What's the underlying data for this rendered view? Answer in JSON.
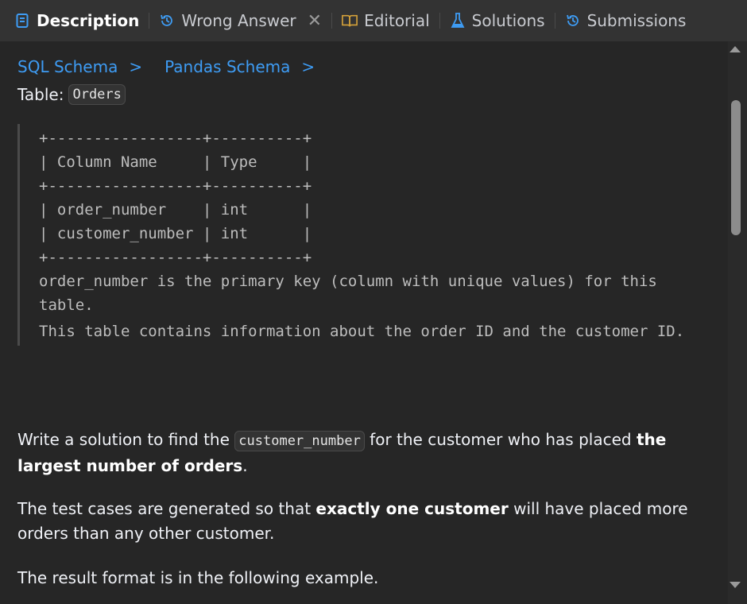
{
  "tabs": [
    {
      "label": "Description",
      "icon": "description-icon",
      "active": true
    },
    {
      "label": "Wrong Answer",
      "icon": "history-icon",
      "closable": true
    },
    {
      "label": "Editorial",
      "icon": "book-icon"
    },
    {
      "label": "Solutions",
      "icon": "flask-icon"
    },
    {
      "label": "Submissions",
      "icon": "history-icon"
    }
  ],
  "breadcrumb": [
    "SQL Schema",
    "Pandas Schema"
  ],
  "table_label": "Table:",
  "table_name": "Orders",
  "schema_ascii": "+-----------------+----------+\n| Column Name     | Type     |\n+-----------------+----------+\n| order_number    | int      |\n| customer_number | int      |\n+-----------------+----------+",
  "schema_notes": [
    "order_number is the primary key (column with unique values) for this table.",
    "This table contains information about the order ID and the customer ID."
  ],
  "problem": {
    "p1_before": "Write a solution to find the ",
    "p1_code": "customer_number",
    "p1_middle": " for the customer who has placed ",
    "p1_bold": "the largest number of orders",
    "p1_after": ".",
    "p2_before": "The test cases are generated so that ",
    "p2_bold": "exactly one customer",
    "p2_after": " will have placed more orders than any other customer.",
    "p3": "The result format is in the following example."
  },
  "colors": {
    "link": "#3e9cf4",
    "tab_bar": "#333333",
    "background": "#262626",
    "editorial_icon": "#d4a13a",
    "solutions_icon": "#3e9cf4",
    "history_icon": "#3e9cf4"
  }
}
